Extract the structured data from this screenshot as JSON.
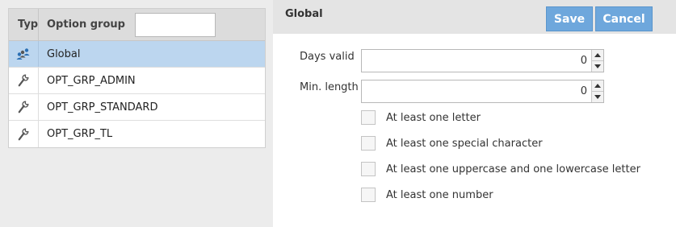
{
  "grid": {
    "header": {
      "type_label": "Type",
      "group_label": "Option group",
      "filter_value": ""
    },
    "rows": [
      {
        "label": "Global",
        "icon": "users-icon",
        "selected": true
      },
      {
        "label": "OPT_GRP_ADMIN",
        "icon": "wrench-icon",
        "selected": false
      },
      {
        "label": "OPT_GRP_STANDARD",
        "icon": "wrench-icon",
        "selected": false
      },
      {
        "label": "OPT_GRP_TL",
        "icon": "wrench-icon",
        "selected": false
      }
    ]
  },
  "detail": {
    "title": "Global",
    "save_label": "Save",
    "cancel_label": "Cancel",
    "fields": {
      "days_valid": {
        "label": "Days valid",
        "value": "0"
      },
      "min_length": {
        "label": "Min. length",
        "value": "0"
      }
    },
    "checks": [
      {
        "label": "At least one letter",
        "checked": false
      },
      {
        "label": "At least one special character",
        "checked": false
      },
      {
        "label": "At least one uppercase and one lowercase letter",
        "checked": false
      },
      {
        "label": "At least one number",
        "checked": false
      }
    ]
  },
  "colors": {
    "accent": "#6ea7dc",
    "selected_row": "#bcd6ef"
  }
}
